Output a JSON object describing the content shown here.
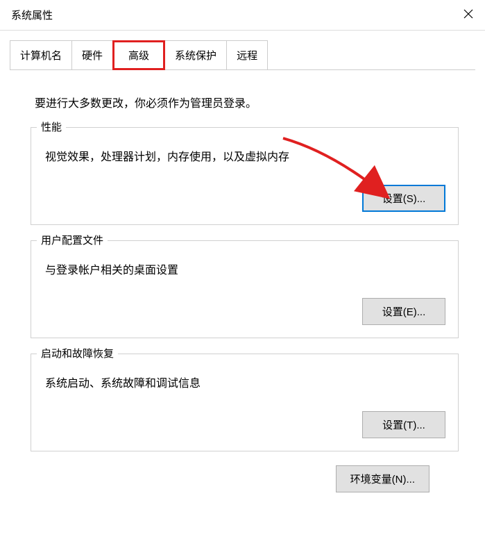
{
  "window": {
    "title": "系统属性"
  },
  "tabs": {
    "computer_name": "计算机名",
    "hardware": "硬件",
    "advanced": "高级",
    "system_protection": "系统保护",
    "remote": "远程"
  },
  "admin_hint": "要进行大多数更改，你必须作为管理员登录。",
  "groups": {
    "performance": {
      "legend": "性能",
      "desc": "视觉效果，处理器计划，内存使用，以及虚拟内存",
      "button": "设置(S)..."
    },
    "profiles": {
      "legend": "用户配置文件",
      "desc": "与登录帐户相关的桌面设置",
      "button": "设置(E)..."
    },
    "startup": {
      "legend": "启动和故障恢复",
      "desc": "系统启动、系统故障和调试信息",
      "button": "设置(T)..."
    }
  },
  "env_button": "环境变量(N)..."
}
